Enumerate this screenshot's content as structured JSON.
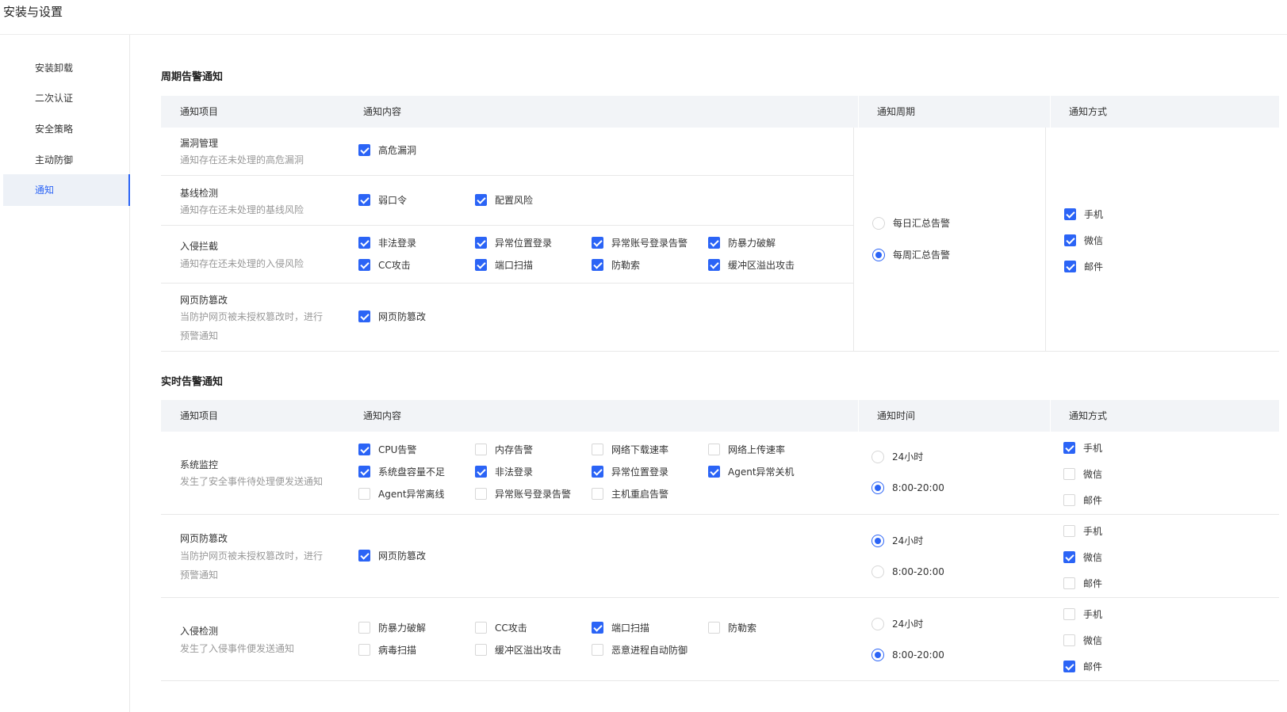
{
  "header": {
    "title": "安装与设置"
  },
  "sidebar": {
    "items": [
      {
        "label": "安装卸载"
      },
      {
        "label": "二次认证"
      },
      {
        "label": "安全策略"
      },
      {
        "label": "主动防御"
      },
      {
        "label": "通知",
        "active": true
      }
    ]
  },
  "periodic": {
    "title": "周期告警通知",
    "headers": {
      "item": "通知项目",
      "content": "通知内容",
      "cycle": "通知周期",
      "method": "通知方式"
    },
    "rows": [
      {
        "title": "漏洞管理",
        "desc": "通知存在还未处理的高危漏洞",
        "options": [
          {
            "label": "高危漏洞",
            "checked": true
          }
        ]
      },
      {
        "title": "基线检测",
        "desc": "通知存在还未处理的基线风险",
        "options": [
          {
            "label": "弱口令",
            "checked": true
          },
          {
            "label": "配置风险",
            "checked": true
          }
        ]
      },
      {
        "title": "入侵拦截",
        "desc": "通知存在还未处理的入侵风险",
        "options": [
          {
            "label": "非法登录",
            "checked": true
          },
          {
            "label": "异常位置登录",
            "checked": true
          },
          {
            "label": "异常账号登录告警",
            "checked": true
          },
          {
            "label": "防暴力破解",
            "checked": true
          },
          {
            "label": "CC攻击",
            "checked": true
          },
          {
            "label": "端口扫描",
            "checked": true
          },
          {
            "label": "防勒索",
            "checked": true
          },
          {
            "label": "缓冲区溢出攻击",
            "checked": true
          }
        ]
      },
      {
        "title": "网页防篡改",
        "desc": "当防护网页被未授权篡改时，进行预警通知",
        "options": [
          {
            "label": "网页防篡改",
            "checked": true
          }
        ]
      }
    ],
    "cycle": [
      {
        "label": "每日汇总告警",
        "selected": false
      },
      {
        "label": "每周汇总告警",
        "selected": true
      }
    ],
    "methods": [
      {
        "label": "手机",
        "checked": true
      },
      {
        "label": "微信",
        "checked": true
      },
      {
        "label": "邮件",
        "checked": true
      }
    ]
  },
  "realtime": {
    "title": "实时告警通知",
    "headers": {
      "item": "通知项目",
      "content": "通知内容",
      "time": "通知时间",
      "method": "通知方式"
    },
    "rows": [
      {
        "title": "系统监控",
        "desc": "发生了安全事件待处理便发送通知",
        "options": [
          {
            "label": "CPU告警",
            "checked": true
          },
          {
            "label": "内存告警",
            "checked": false
          },
          {
            "label": "网络下载速率",
            "checked": false
          },
          {
            "label": "网络上传速率",
            "checked": false
          },
          {
            "label": "系统盘容量不足",
            "checked": true
          },
          {
            "label": "非法登录",
            "checked": true
          },
          {
            "label": "异常位置登录",
            "checked": true
          },
          {
            "label": "Agent异常关机",
            "checked": true
          },
          {
            "label": "Agent异常离线",
            "checked": false
          },
          {
            "label": "异常账号登录告警",
            "checked": false
          },
          {
            "label": "主机重启告警",
            "checked": false
          }
        ],
        "time": [
          {
            "label": "24小时",
            "selected": false
          },
          {
            "label": "8:00-20:00",
            "selected": true
          }
        ],
        "methods": [
          {
            "label": "手机",
            "checked": true
          },
          {
            "label": "微信",
            "checked": false
          },
          {
            "label": "邮件",
            "checked": false
          }
        ]
      },
      {
        "title": "网页防篡改",
        "desc": "当防护网页被未授权篡改时，进行预警通知",
        "options": [
          {
            "label": "网页防篡改",
            "checked": true
          }
        ],
        "time": [
          {
            "label": "24小时",
            "selected": true
          },
          {
            "label": "8:00-20:00",
            "selected": false
          }
        ],
        "methods": [
          {
            "label": "手机",
            "checked": false
          },
          {
            "label": "微信",
            "checked": true
          },
          {
            "label": "邮件",
            "checked": false
          }
        ]
      },
      {
        "title": "入侵检测",
        "desc": "发生了入侵事件便发送通知",
        "options": [
          {
            "label": "防暴力破解",
            "checked": false
          },
          {
            "label": "CC攻击",
            "checked": false
          },
          {
            "label": "端口扫描",
            "checked": true
          },
          {
            "label": "防勒索",
            "checked": false
          },
          {
            "label": "病毒扫描",
            "checked": false
          },
          {
            "label": "缓冲区溢出攻击",
            "checked": false
          },
          {
            "label": "恶意进程自动防御",
            "checked": false
          }
        ],
        "time": [
          {
            "label": "24小时",
            "selected": false
          },
          {
            "label": "8:00-20:00",
            "selected": true
          }
        ],
        "methods": [
          {
            "label": "手机",
            "checked": false
          },
          {
            "label": "微信",
            "checked": false
          },
          {
            "label": "邮件",
            "checked": true
          }
        ]
      }
    ]
  }
}
